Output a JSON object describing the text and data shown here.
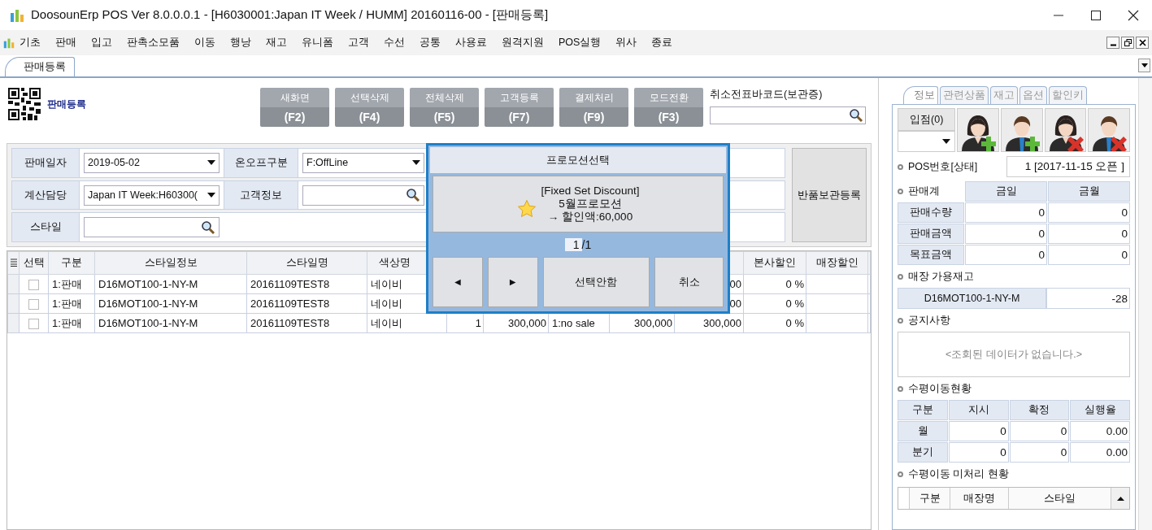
{
  "window": {
    "title": "DoosounErp POS Ver 8.0.0.0.1 - [H6030001:Japan IT Week / HUMM] 20160116-00 - [판매등록]"
  },
  "menu": [
    "기초",
    "판매",
    "입고",
    "판촉소모품",
    "이동",
    "행낭",
    "재고",
    "유니폼",
    "고객",
    "수선",
    "공통",
    "사용료",
    "원격지원",
    "POS실행",
    "위사",
    "종료"
  ],
  "tabs": [
    {
      "label": "판매등록",
      "selected": true
    }
  ],
  "header": {
    "title": "판매등록"
  },
  "toolbar": [
    {
      "label": "새화면",
      "key": "(F2)"
    },
    {
      "label": "선택삭제",
      "key": "(F4)"
    },
    {
      "label": "전체삭제",
      "key": "(F5)"
    },
    {
      "label": "고객등록",
      "key": "(F7)"
    },
    {
      "label": "결제처리",
      "key": "(F9)"
    },
    {
      "label": "모드전환",
      "key": "(F3)"
    }
  ],
  "barcode": {
    "label": "취소전표바코드(보관증)"
  },
  "form": {
    "rows": [
      [
        {
          "label": "판매일자",
          "kind": "dropdown",
          "value": "2019-05-02"
        },
        {
          "label": "온오프구분",
          "kind": "dropdown",
          "value": "F:OffLine"
        }
      ],
      [
        {
          "label": "계산담당",
          "kind": "dropdown",
          "value": "Japan IT Week:H60300("
        },
        {
          "label": "고객정보",
          "kind": "search"
        }
      ],
      [
        {
          "label": "스타일",
          "kind": "search"
        }
      ]
    ],
    "return_button": "반품보관등록"
  },
  "table": {
    "columns": [
      "선택",
      "구분",
      "스타일정보",
      "스타일명",
      "색상명",
      "본사할인",
      "매장할인"
    ],
    "rows": [
      {
        "checked": false,
        "type": "1:판매",
        "style_info": "D16MOT100-1-NY-M",
        "style_name": "20161109TEST8",
        "color_name": "네이비",
        "column_11": "00",
        "hq_discount": "0 %"
      },
      {
        "checked": false,
        "type": "1:판매",
        "style_info": "D16MOT100-1-NY-M",
        "style_name": "20161109TEST8",
        "color_name": "네이비",
        "column_11": "00",
        "hq_discount": "0 %"
      },
      {
        "checked": false,
        "type": "1:판매",
        "style_info": "D16MOT100-1-NY-M",
        "style_name": "20161109TEST8",
        "color_name": "네이비",
        "column_7": "1",
        "column_8": "300,000",
        "column_9": "1:no sale",
        "column_10": "300,000",
        "column_11": "300,000",
        "hq_discount": "0 %"
      }
    ]
  },
  "promotion_dialog": {
    "title": "프로모션선택",
    "promotion": {
      "tag": "[Fixed Set Discount]",
      "name": "5월프로모션",
      "amount": "→ 할인액:60,000"
    },
    "page": "1",
    "pages": "/1",
    "buttons": [
      "◄",
      "►",
      "선택안함",
      "취소"
    ]
  },
  "side_tabs": [
    {
      "label": "정보",
      "selected": true
    },
    {
      "label": "관련상품",
      "selected": false
    },
    {
      "label": "재고",
      "selected": false
    },
    {
      "label": "옵션",
      "selected": false
    },
    {
      "label": "할인키",
      "selected": false
    }
  ],
  "store": {
    "label": "입점(0)"
  },
  "pos": {
    "label": "POS번호[상태]",
    "value": "1 [2017-11-15 오픈 ]"
  },
  "sales": {
    "label": "판매계",
    "columns": [
      "금일",
      "금월"
    ],
    "rows": [
      {
        "label": "판매수량",
        "values": [
          "0",
          "0"
        ]
      },
      {
        "label": "판매금액",
        "values": [
          "0",
          "0"
        ]
      },
      {
        "label": "목표금액",
        "values": [
          "0",
          "0"
        ]
      }
    ]
  },
  "stock": {
    "label": "매장 가용재고",
    "style": "D16MOT100-1-NY-M",
    "qty": "-28"
  },
  "notice": {
    "label": "공지사항",
    "empty": "<조회된 데이터가 없습니다.>"
  },
  "transfer": {
    "label": "수평이동현황",
    "columns": [
      "구분",
      "지시",
      "확정",
      "실행율"
    ],
    "rows": [
      {
        "label": "월",
        "values": [
          "0",
          "0",
          "0.00"
        ]
      },
      {
        "label": "분기",
        "values": [
          "0",
          "0",
          "0.00"
        ]
      }
    ]
  },
  "pending": {
    "label": "수평이동 미처리 현황",
    "columns": [
      "구분",
      "매장명",
      "스타일"
    ]
  }
}
